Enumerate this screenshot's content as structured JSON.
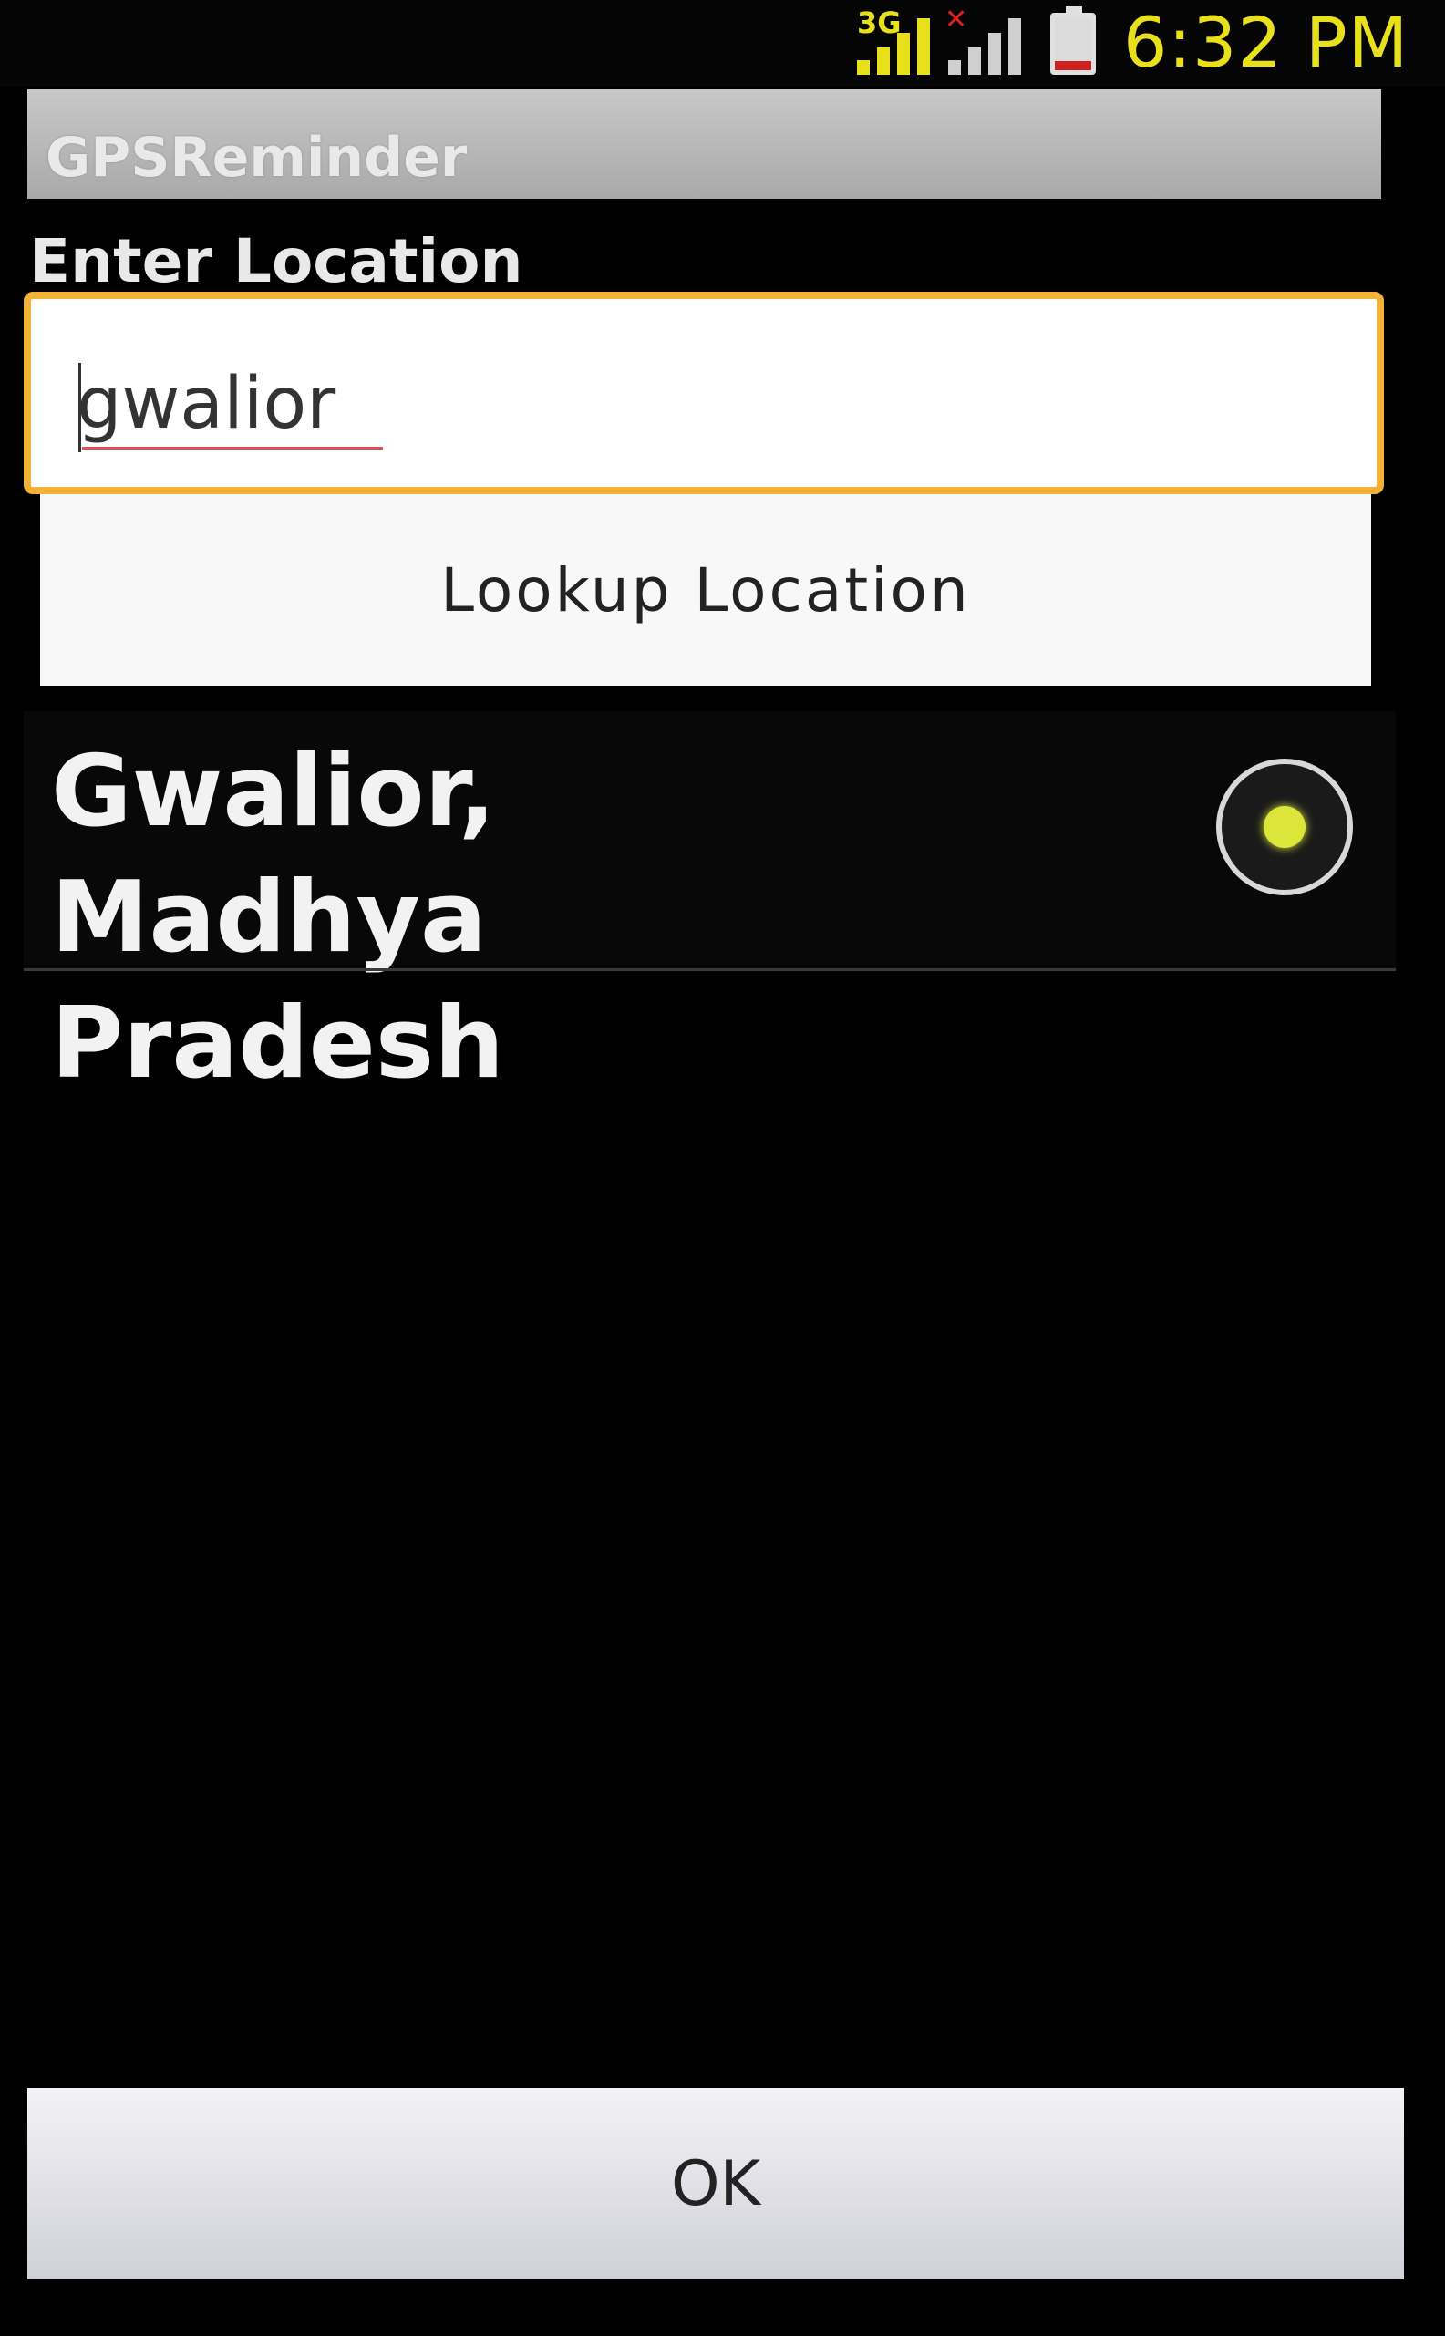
{
  "status_bar": {
    "network_label": "3G",
    "time": "6:32 PM",
    "icons": [
      "signal-3g-icon",
      "signal-no-sim-icon",
      "battery-low-icon"
    ],
    "accent_color": "#e8e01a"
  },
  "app": {
    "title": "GPSReminder"
  },
  "form": {
    "location_label": "Enter Location",
    "location_value": "gwalior",
    "lookup_button_label": "Lookup Location"
  },
  "results": {
    "items": [
      {
        "label": "Gwalior, Madhya Pradesh",
        "selected": true
      }
    ]
  },
  "footer": {
    "ok_label": "OK"
  }
}
